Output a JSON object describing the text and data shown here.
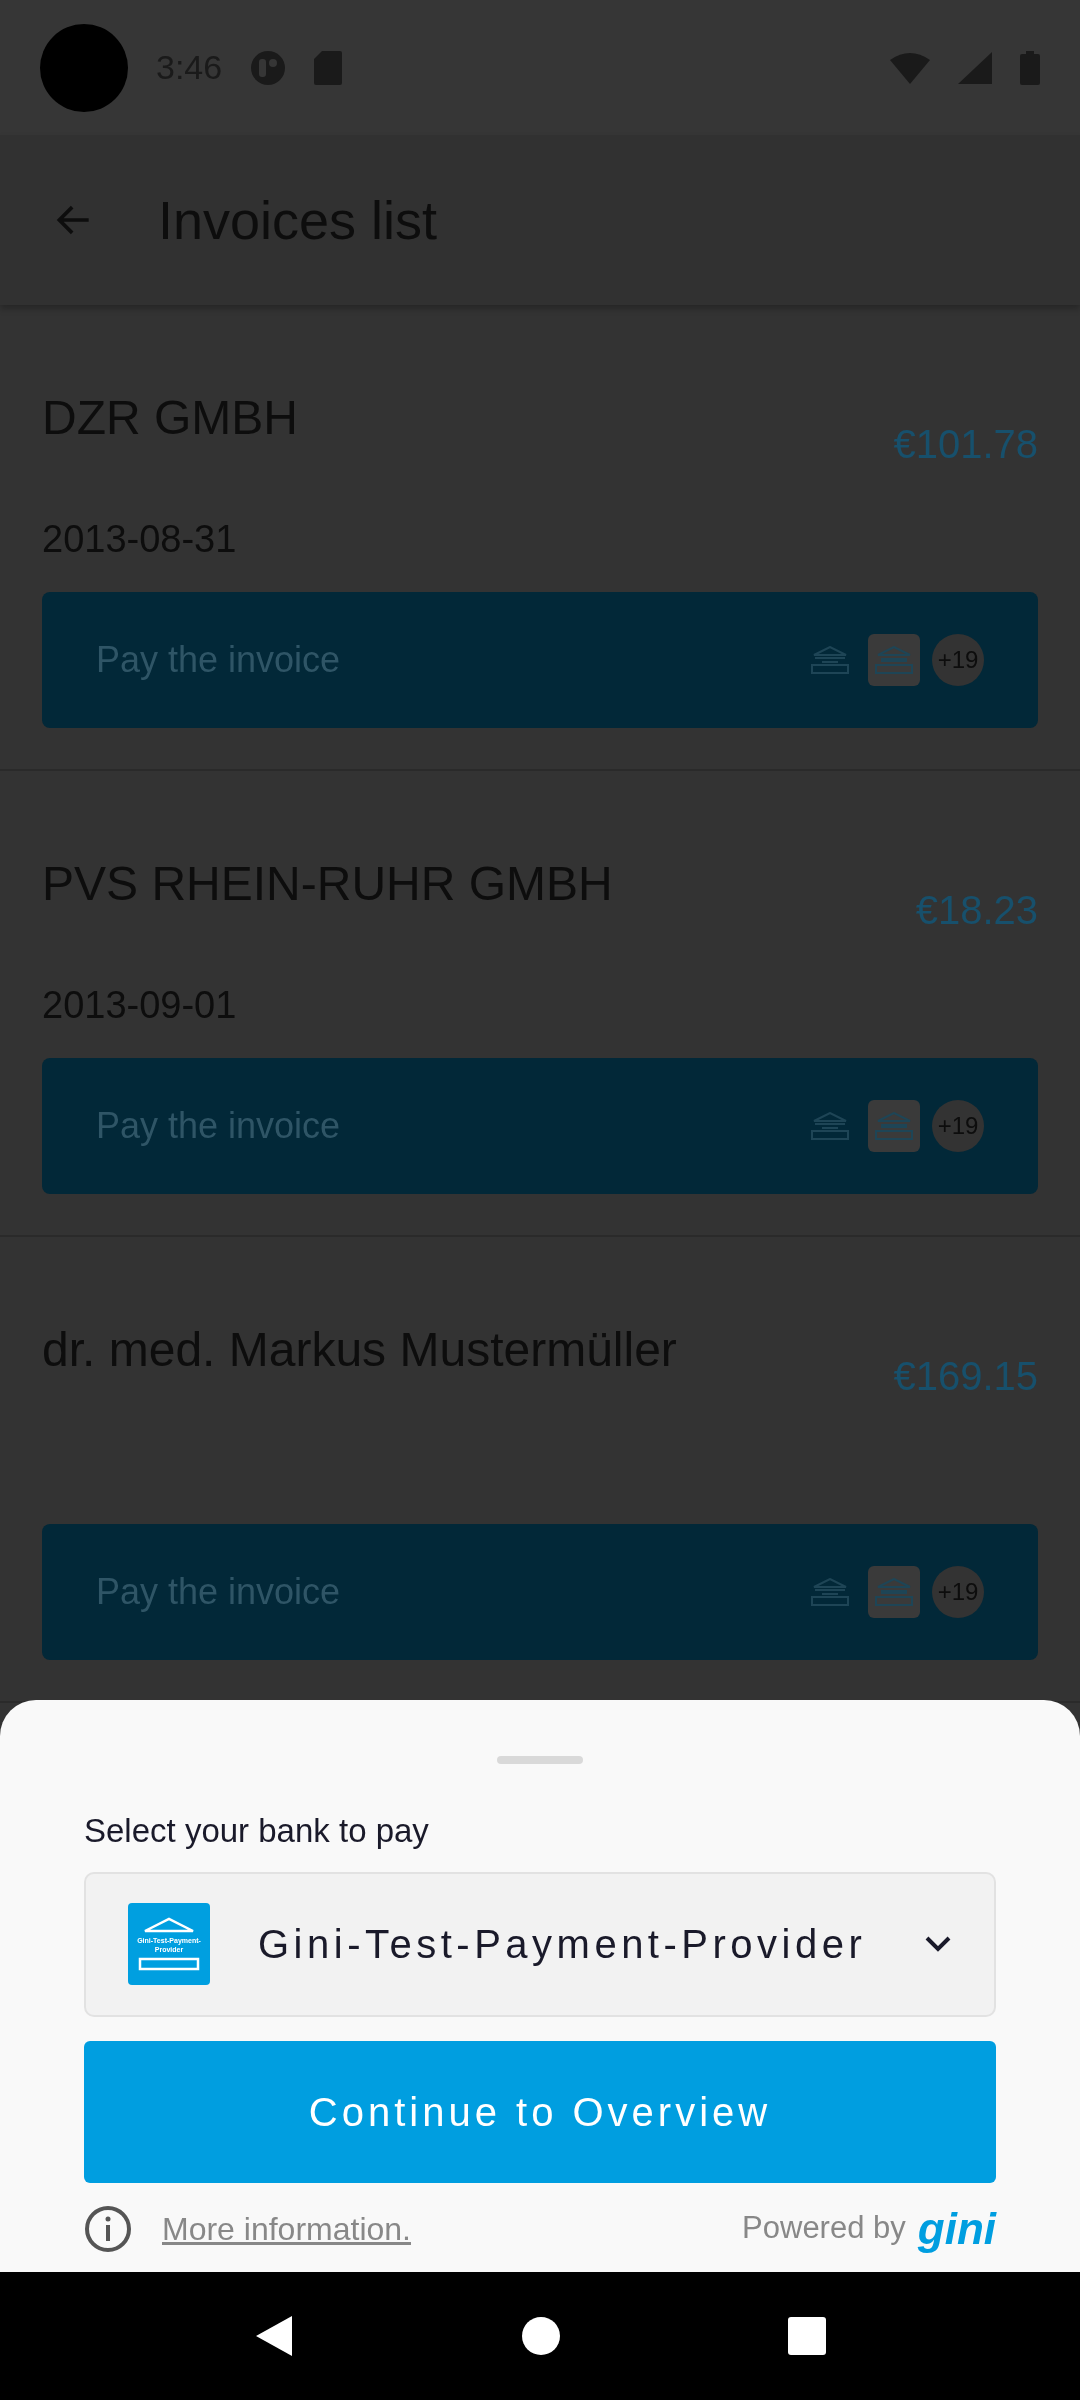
{
  "status_bar": {
    "time": "3:46"
  },
  "app_bar": {
    "title": "Invoices list"
  },
  "invoices": [
    {
      "name": "DZR GMBH",
      "amount": "€101.78",
      "date": "2013-08-31",
      "pay_button": {
        "label": "Pay the invoice",
        "logos": [
          {
            "kind": "plain"
          },
          {
            "kind": "tile"
          }
        ],
        "more": "+19"
      }
    },
    {
      "name": "PVS RHEIN-RUHR GMBH",
      "amount": "€18.23",
      "date": "2013-09-01",
      "pay_button": {
        "label": "Pay the invoice",
        "logos": [
          {
            "kind": "plain"
          },
          {
            "kind": "tile"
          }
        ],
        "more": "+19"
      }
    },
    {
      "name": "dr. med. Markus Mustermüller",
      "amount": "€169.15",
      "pay_button": {
        "label": "Pay the invoice",
        "logos": [
          {
            "kind": "plain"
          },
          {
            "kind": "tile"
          }
        ],
        "more": "+19"
      }
    }
  ],
  "bank_sheet": {
    "label": "Select your bank to pay",
    "selected_bank": {
      "name": "Gini-Test-Payment-Provider",
      "logo_text": "Gini-Test-Payment-Provider"
    },
    "continue_button": "Continue to Overview",
    "more_info_link": "More information.",
    "powered_by": "Powered by",
    "brand": "gini"
  }
}
